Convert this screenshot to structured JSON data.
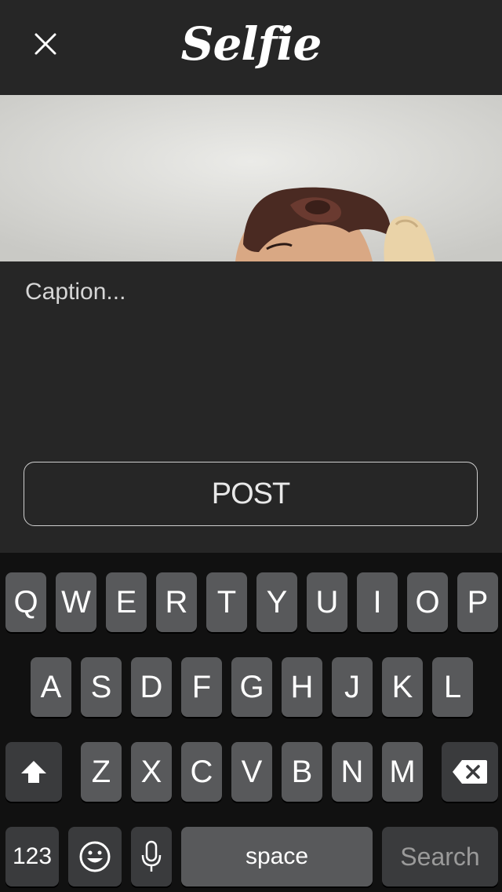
{
  "header": {
    "brand": "Selfie",
    "close_icon": "close-icon"
  },
  "caption": {
    "placeholder": "Caption..."
  },
  "post_label": "POST",
  "keyboard": {
    "row1": [
      "Q",
      "W",
      "E",
      "R",
      "T",
      "Y",
      "U",
      "I",
      "O",
      "P"
    ],
    "row2": [
      "A",
      "S",
      "D",
      "F",
      "G",
      "H",
      "J",
      "K",
      "L"
    ],
    "row3": [
      "Z",
      "X",
      "C",
      "V",
      "B",
      "N",
      "M"
    ],
    "numbers_label": "123",
    "space_label": "space",
    "search_label": "Search",
    "shift_icon": "shift-icon",
    "delete_icon": "delete-icon",
    "emoji_icon": "emoji-icon",
    "mic_icon": "microphone-icon"
  },
  "colors": {
    "background": "#262626",
    "key": "#58595b",
    "key_dark": "#3a3b3d",
    "keyboard": "#111111"
  }
}
